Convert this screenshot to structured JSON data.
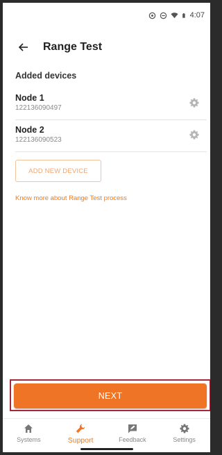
{
  "statusbar": {
    "time": "4:07"
  },
  "header": {
    "title": "Range Test",
    "back_icon": "arrow-left-icon"
  },
  "section": {
    "label": "Added devices"
  },
  "devices": [
    {
      "name": "Node 1",
      "serial": "122136090497"
    },
    {
      "name": "Node 2",
      "serial": "122136090523"
    }
  ],
  "actions": {
    "add_device_label": "ADD NEW DEVICE",
    "know_more_link": "Know more about Range Test process",
    "next_label": "NEXT"
  },
  "nav": {
    "items": [
      {
        "label": "Systems",
        "icon": "home-icon"
      },
      {
        "label": "Support",
        "icon": "wrench-icon"
      },
      {
        "label": "Feedback",
        "icon": "feedback-icon"
      },
      {
        "label": "Settings",
        "icon": "gear-icon"
      }
    ],
    "active": "Support"
  },
  "colors": {
    "accent": "#f07426",
    "highlight_frame": "#a8283b",
    "inactive": "#8a8a8a"
  }
}
